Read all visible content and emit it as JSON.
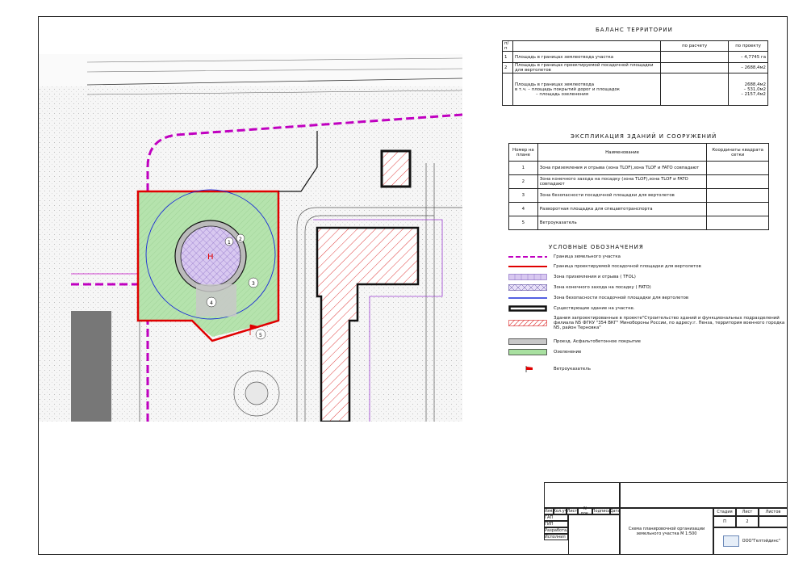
{
  "balance": {
    "title": "БАЛАНС ТЕРРИТОРИИ",
    "headers": [
      "п/п",
      "",
      "по расчету",
      "по проекту"
    ],
    "rows": [
      {
        "num": "1",
        "name": "Площадь в границах землеотвода участка",
        "calc": "",
        "proj": "– 4,7745 га"
      },
      {
        "num": "2",
        "name": "Площадь в границах проектируемой посадочной площадки для вертолетов",
        "calc": "",
        "proj": "– 2688,4м2"
      },
      {
        "num": "",
        "name": "Площадь в границах землеотвода",
        "name2": "в т.ч.   – площадь покрытий дорог и площадок",
        "name3": "– площадь озеленения",
        "calc": "",
        "proj": "2688,4м2",
        "proj2": "– 531,0м2",
        "proj3": "– 2157,4м2"
      }
    ]
  },
  "explication": {
    "title": "ЭКСПЛИКАЦИЯ ЗДАНИЙ И СООРУЖЕНИЙ",
    "headers": [
      "Номер на плане",
      "Наименование",
      "Координаты квадрата сетки"
    ],
    "rows": [
      {
        "num": "1",
        "name": "Зона приземления и отрыва (зона TLOF),зона TLOF и FATO совпадают"
      },
      {
        "num": "2",
        "name": "Зона конечного захода на посадку (зона TLOF),зона TLOF и FATO совпадают"
      },
      {
        "num": "3",
        "name": "Зона безопасности посадочной площадки для вертолетов"
      },
      {
        "num": "4",
        "name": "Разворотная площадка для спецавтотранспорта"
      },
      {
        "num": "5",
        "name": "Ветроуказатель"
      }
    ]
  },
  "legend": {
    "title": "УСЛОВНЫЕ ОБОЗНАЧЕНИЯ",
    "items": [
      {
        "text": "Граница земельного участка"
      },
      {
        "text": "Граница проектируемой посадочной площадки для вертолетов"
      },
      {
        "text": "Зона приземления и отрыва ( TFOL)"
      },
      {
        "text": "Зона конечного захода на посадку ( FATO)"
      },
      {
        "text": "Зона безопасности посадочной площадки для вертолетов"
      },
      {
        "text": "Существующие здание на участке."
      },
      {
        "text": "Здания запроектированные в проекте\"Строительство зданий и функциональных подразделений филиала N5 ФГКУ \"354 ВКГ\" Минобороны России, по адресу:г. Пенза, территория военного городка N5, район Терновка\""
      },
      {
        "text": "Проезд. Асфальтобетонное покрытие"
      },
      {
        "text": "Озеленение"
      },
      {
        "text": "Ветроуказатель"
      }
    ]
  },
  "stamp": {
    "cols": [
      "Изм.",
      "Кол.уч",
      "Лист",
      "N док.",
      "Подпись",
      "Дата"
    ],
    "roles": [
      "ГАП",
      "ГИП",
      "Разработал",
      "Исполнил"
    ],
    "stage_label": "Стадия",
    "sheet_label": "Лист",
    "sheets_label": "Листов",
    "stage": "П",
    "sheet": "2",
    "drawing_title": "Схема планировочной организации земельного участка М 1:500",
    "company": "ООО\"Гелтэйдинс\""
  },
  "plan": {
    "zone_labels": [
      "H",
      "1",
      "2",
      "3",
      "4",
      "5"
    ]
  },
  "colors": {
    "boundary": "#c000c0",
    "helipad_border": "#e00000",
    "green": "#a8e0a0",
    "safety_zone": "#1a2bd8"
  }
}
